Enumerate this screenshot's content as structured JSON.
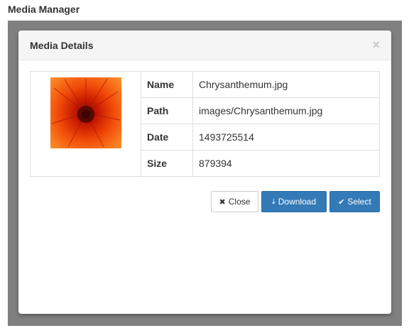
{
  "app": {
    "title": "Media Manager"
  },
  "modal": {
    "title": "Media Details",
    "close_glyph": "×"
  },
  "details": {
    "rows": [
      {
        "label": "Name",
        "value": "Chrysanthemum.jpg"
      },
      {
        "label": "Path",
        "value": "images/Chrysanthemum.jpg"
      },
      {
        "label": "Date",
        "value": "1493725514"
      },
      {
        "label": "Size",
        "value": "879394"
      }
    ]
  },
  "buttons": {
    "close_label": "Close",
    "download_label": "Download",
    "select_label": "Select",
    "close_icon_glyph": "✖",
    "download_icon_glyph": "⤓",
    "select_icon_glyph": "✔"
  },
  "colors": {
    "primary": "#337ab7",
    "backdrop": "#808080"
  },
  "icons": {
    "thumbnail": "chrysanthemum-image"
  }
}
